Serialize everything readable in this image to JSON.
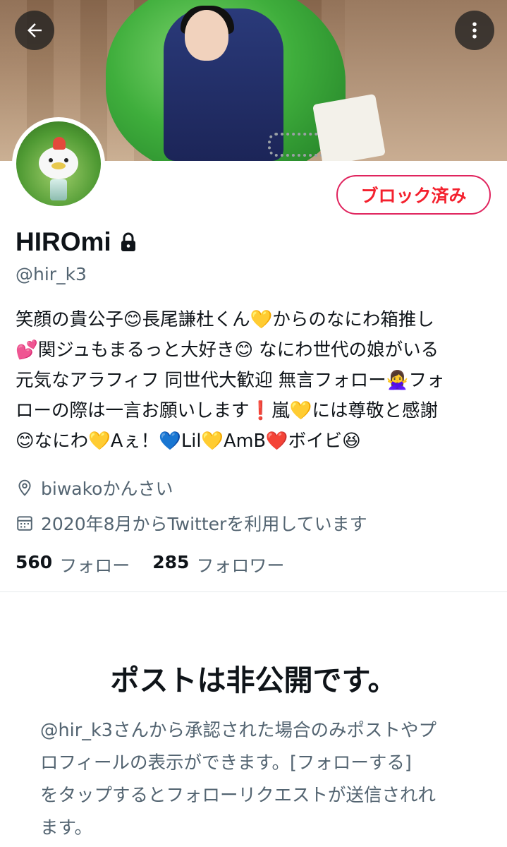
{
  "header": {
    "back_icon": "arrow-left-icon",
    "more_icon": "more-vertical-icon"
  },
  "profile": {
    "block_button_label": "ブロック済み",
    "display_name": "HIROmi",
    "protected_icon": "lock-icon",
    "handle": "@hir_k3",
    "bio_lines": [
      "笑顔の貴公子😊長尾謙杜くん💛からのなにわ箱推し",
      "💕関ジュもまるっと大好き😊 なにわ世代の娘がいる",
      "元気なアラフィフ 同世代大歓迎 無言フォロー🙅‍♀️フォ",
      "ローの際は一言お願いします❗️嵐💛には尊敬と感謝",
      "😊なにわ💛Aぇ！💙Lil💛AmB❤️ボイビ😆"
    ],
    "location": "biwakoかんさい",
    "location_icon": "location-pin-icon",
    "joined": "2020年8月からTwitterを利用しています",
    "joined_icon": "calendar-icon",
    "following_count": "560",
    "following_label": "フォロー",
    "followers_count": "285",
    "followers_label": "フォロワー"
  },
  "protected_notice": {
    "title": "ポストは非公開です。",
    "description_lines": [
      "@hir_k3さんから承認された場合のみポストやプ",
      "ロフィールの表示ができます。[フォローする]",
      "をタップするとフォローリクエストが送信されれ",
      "ます。"
    ]
  },
  "colors": {
    "block_red": "#f4212e",
    "text_primary": "#0f1419",
    "text_secondary": "#536471"
  }
}
